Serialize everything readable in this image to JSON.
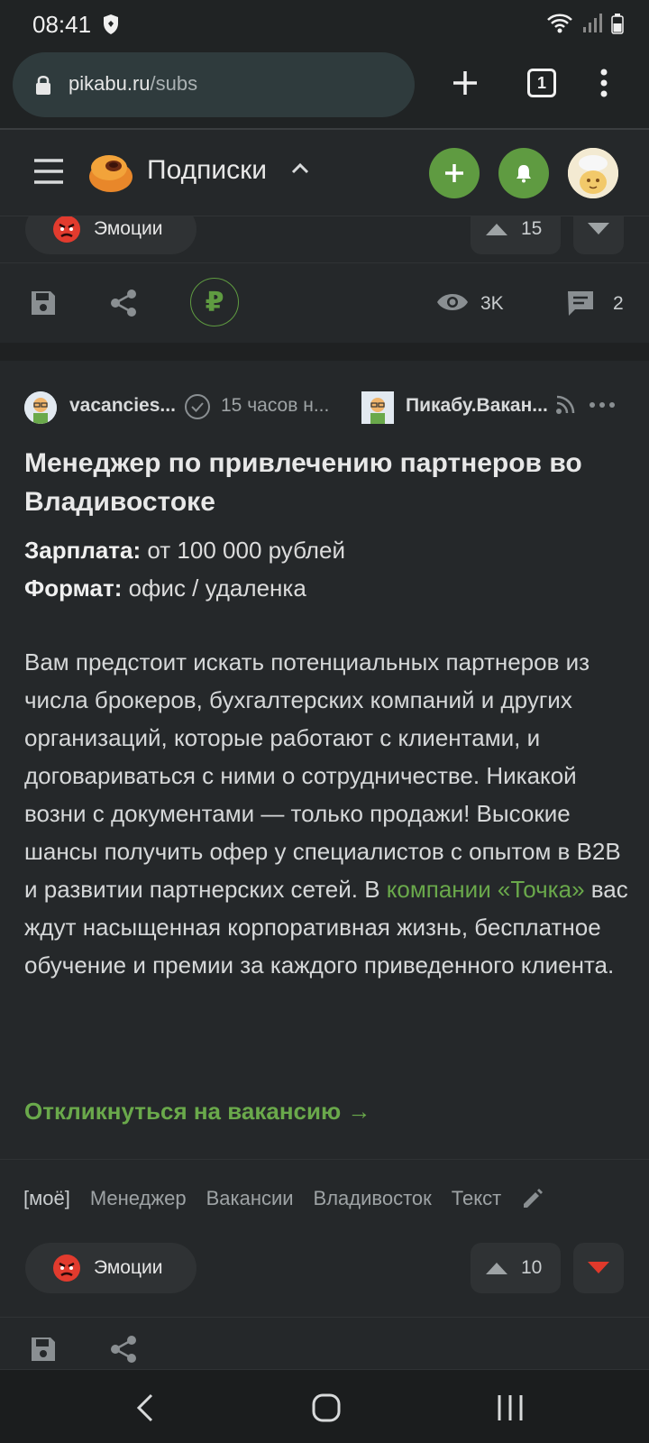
{
  "status": {
    "time": "08:41"
  },
  "browser": {
    "url_host": "pikabu.ru",
    "url_path": "/subs",
    "tab_count": "1"
  },
  "header": {
    "title": "Подписки"
  },
  "prev_post": {
    "emotions_label": "Эмоции",
    "votes": "15",
    "views": "3K",
    "comments": "2"
  },
  "post": {
    "author": "vacancies...",
    "time": "15 часов н...",
    "community": "Пикабу.Вакан...",
    "title": "Менеджер по привлечению партнеров во Владивостоке",
    "salary_label": "Зарплата:",
    "salary_value": " от 100 000 рублей",
    "format_label": "Формат:",
    "format_value": " офис / удаленка",
    "body_1": "Вам предстоит искать потенциальных партнеров из числа брокеров, бухгалтерских компаний и других организаций, которые работают с клиентами, и договариваться с ними о сотрудничестве. Никакой возни с документами — только продажи! Высокие шансы получить офер у специалистов с опытом в B2B и развитии партнерских сетей. В ",
    "body_link": "компании «Точка»",
    "body_2": " вас ждут насыщенная корпоративная жизнь, бесплатное обучение и премии за каждого приведенного клиента.",
    "apply": "Откликнуться на вакансию →",
    "tags": [
      "[моё]",
      "Менеджер",
      "Вакансии",
      "Владивосток",
      "Текст"
    ],
    "emotions_label": "Эмоции",
    "votes": "10"
  },
  "colors": {
    "accent": "#5f9b41",
    "link": "#6aa94b",
    "downvote": "#e0392b"
  }
}
